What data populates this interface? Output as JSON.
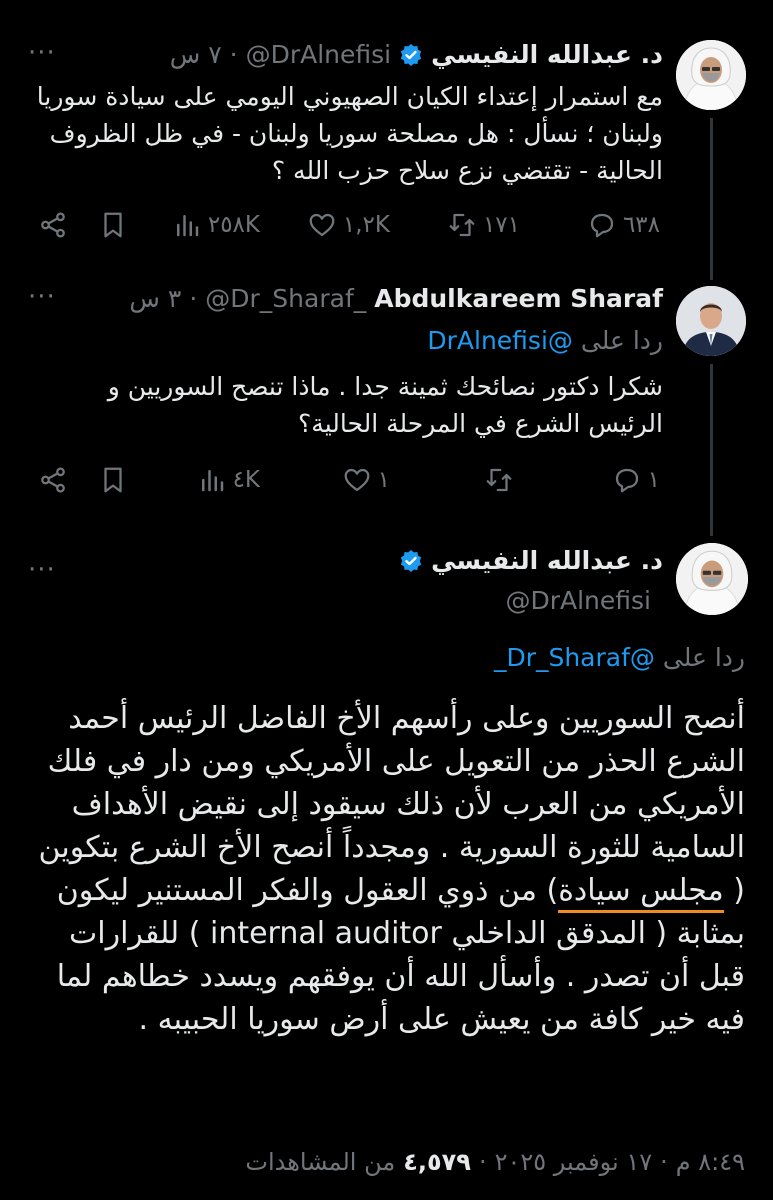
{
  "tweet1": {
    "author_name": "د. عبدالله النفيسي",
    "handle": "@DrAlnefisi",
    "time": "٧ س",
    "sep": "·",
    "text": "مع استمرار إعتداء الكيان الصهيوني اليومي على سيادة سوريا ولبنان ؛ نسأل : هل مصلحة سوريا ولبنان - في ظل الظروف الحالية - تقتضي نزع سلاح حزب الله  ؟",
    "replies": "٦٣٨",
    "retweets": "١٧١",
    "likes": "١,٢K",
    "views": "٢٥٨K"
  },
  "tweet2": {
    "author_name": "Abdulkareem Sharaf",
    "handle": "@Dr_Sharaf_",
    "time": "٣ س",
    "sep": "·",
    "reply_prefix": "ردا على",
    "reply_handle": "@DrAlnefisi",
    "text": "شكرا دكتور نصائحك ثمينة جدا . ماذا تنصح السوريين و الرئيس الشرع في المرحلة الحالية؟",
    "replies": "١",
    "retweets": "",
    "likes": "١",
    "views": "٤K"
  },
  "tweet3": {
    "author_name": "د. عبدالله النفيسي",
    "handle": "@DrAlnefisi",
    "reply_prefix": "ردا على",
    "reply_handle": "@Dr_Sharaf_",
    "text_before": "أنصح السوريين وعلى رأسهم الأخ الفاضل الرئيس أحمد الشرع الحذر من التعويل على الأمريكي ومن دار في فلك الأمريكي من العرب لأن ذلك سيقود إلى نقيض الأهداف السامية للثورة السورية . ومجدداً أنصح الأخ الشرع بتكوين ( ",
    "text_highlight": "مجلس سيادة",
    "text_after": ") من ذوي العقول والفكر المستنير ليكون بمثابة ( المدقق الداخلي internal auditor ) للقرارات قبل أن تصدر . وأسأل الله أن يوفقهم ويسدد خطاهم لما فيه خير كافة من يعيش على أرض سوريا الحبيبه .",
    "time": "٨:٤٩ م",
    "date": "١٧ نوفمبر ٢٠٢٥",
    "sep": "·",
    "views_count": "٤,٥٧٩",
    "views_label": "من المشاهدات"
  },
  "colors": {
    "background": "#000000",
    "text": "#e7e9ea",
    "muted": "#71767b",
    "link": "#1d9bf0",
    "verified": "#1d9bf0",
    "highlight_underline": "#f08a24"
  },
  "icons": [
    "more-icon",
    "verified-badge-icon",
    "reply-icon",
    "retweet-icon",
    "like-icon",
    "views-icon",
    "bookmark-icon",
    "share-icon"
  ]
}
